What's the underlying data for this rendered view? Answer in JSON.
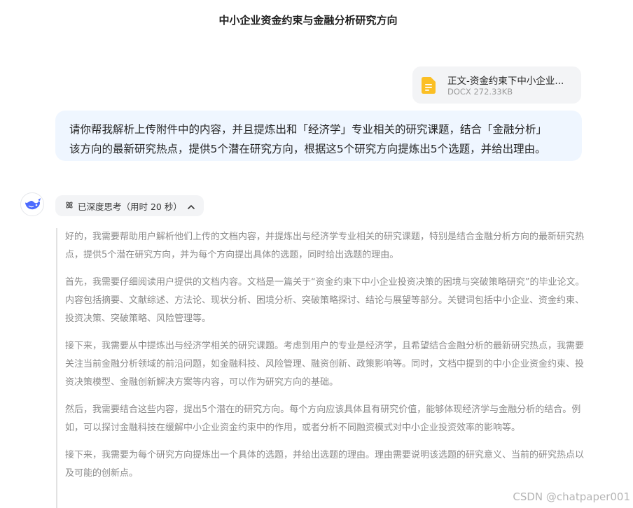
{
  "conversation": {
    "title": "中小企业资金约束与金融分析研究方向"
  },
  "attachment": {
    "icon": "document-icon",
    "name": "正文-资金约束下中小企业...",
    "meta": "DOCX 272.33KB",
    "icon_color": "#fbbf24"
  },
  "user_message": {
    "lines": [
      "请你帮我解析上传附件中的内容，并且提炼出和「经济学」专业相关的研究课题，结合「金融分析」",
      "该方向的最新研究热点，提供5个潜在研究方向，根据这5个研究方向提炼出5个选题，并给出理由。"
    ]
  },
  "assistant": {
    "avatar_icon": "whale-logo-icon",
    "brand_color": "#4d6bfe",
    "thinking_label": "已深度思考（用时 20 秒）",
    "thinking_paragraphs": [
      "好的，我需要帮助用户解析他们上传的文档内容，并提炼出与经济学专业相关的研究课题，特别是结合金融分析方向的最新研究热点，提供5个潜在研究方向，并为每个方向提出具体的选题，同时给出选题的理由。",
      "首先，我需要仔细阅读用户提供的文档内容。文档是一篇关于“资金约束下中小企业投资决策的困境与突破策略研究”的毕业论文。内容包括摘要、文献综述、方法论、现状分析、困境分析、突破策略探讨、结论与展望等部分。关键词包括中小企业、资金约束、投资决策、突破策略、风险管理等。",
      "接下来，我需要从中提炼出与经济学相关的研究课题。考虑到用户的专业是经济学，且希望结合金融分析的最新研究热点，我需要关注当前金融分析领域的前沿问题，如金融科技、风险管理、融资创新、政策影响等。同时，文档中提到的中小企业资金约束、投资决策模型、金融创新解决方案等内容，可以作为研究方向的基础。",
      "然后，我需要结合这些内容，提出5个潜在的研究方向。每个方向应该具体且有研究价值，能够体现经济学与金融分析的结合。例如，可以探讨金融科技在缓解中小企业资金约束中的作用，或者分析不同融资模式对中小企业投资效率的影响等。",
      "接下来，我需要为每个研究方向提炼出一个具体的选题，并给出选题的理由。理由需要说明该选题的研究意义、当前的研究热点以及可能的创新点。"
    ]
  },
  "watermark": "CSDN @chatpaper001"
}
